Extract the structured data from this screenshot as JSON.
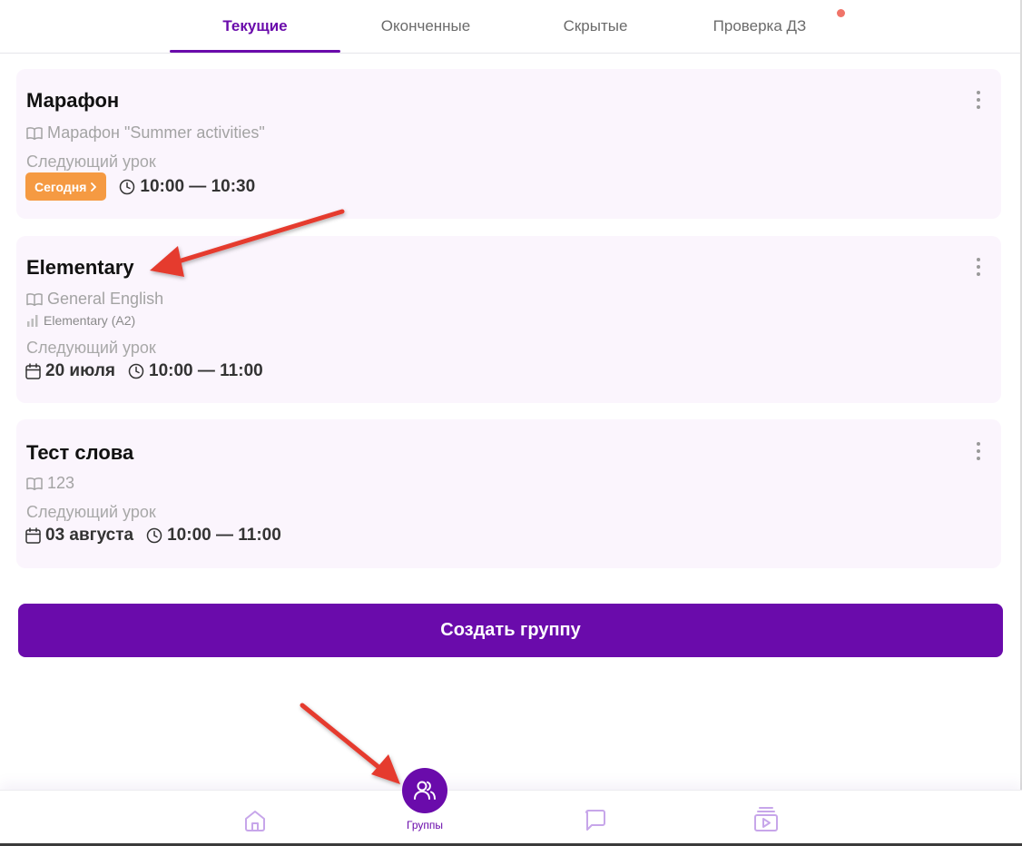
{
  "tabs": [
    {
      "label": "Текущие",
      "active": true
    },
    {
      "label": "Оконченные",
      "active": false
    },
    {
      "label": "Скрытые",
      "active": false
    },
    {
      "label": "Проверка ДЗ",
      "active": false,
      "has_notification": true
    }
  ],
  "groups": [
    {
      "title": "Марафон",
      "course": "Марафон \"Summer activities\"",
      "next_lesson_label": "Следующий урок",
      "today_badge": "Сегодня",
      "time": "10:00 — 10:30"
    },
    {
      "title": "Elementary",
      "course": "General English",
      "level": "Elementary (A2)",
      "next_lesson_label": "Следующий урок",
      "date": "20 июля",
      "time": "10:00 — 11:00"
    },
    {
      "title": "Тест слова",
      "course": "123",
      "next_lesson_label": "Следующий урок",
      "date": "03 августа",
      "time": "10:00 — 11:00"
    }
  ],
  "create_button": "Создать группу",
  "bottom_nav": {
    "items": [
      {
        "icon": "home-icon"
      },
      {
        "icon": "groups-icon",
        "label": "Группы",
        "active": true
      },
      {
        "icon": "chat-icon"
      },
      {
        "icon": "video-library-icon"
      }
    ]
  },
  "colors": {
    "accent": "#6a0bab",
    "card_bg": "#fbf5fd",
    "today_badge": "#f59a42",
    "notification": "#f07469",
    "annotation_arrow": "#e53a2f"
  }
}
